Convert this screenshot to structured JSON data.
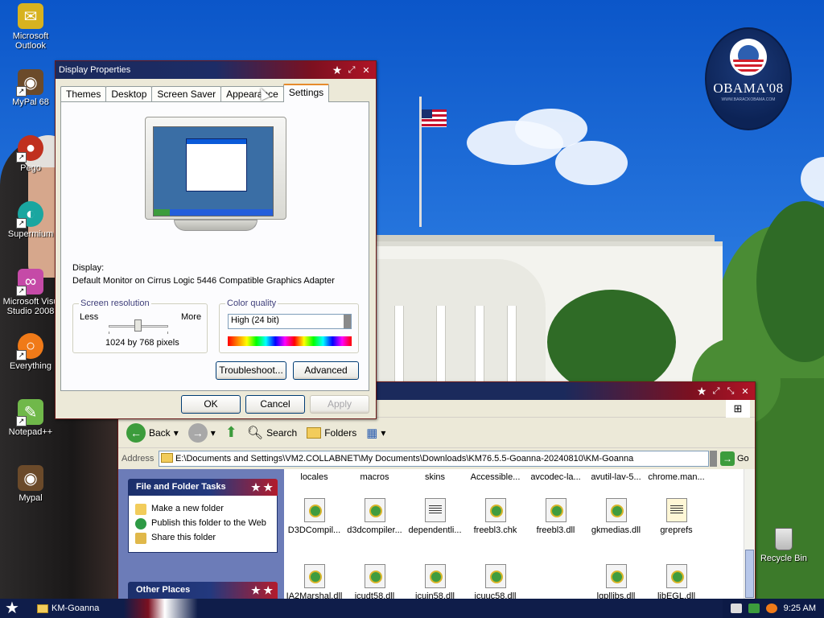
{
  "desktop": {
    "icons": [
      {
        "label": "Microsoft\nOutlook",
        "icon": "outlook-icon",
        "color": "#d7b21f"
      },
      {
        "label": "MyPal 68",
        "icon": "mypal-raccoon-icon",
        "color": "#6b4a2a"
      },
      {
        "label": "Pego",
        "icon": "pego-icon",
        "color": "#c0301e"
      },
      {
        "label": "Supermium",
        "icon": "supermium-icon",
        "color": "#1aa6a0"
      },
      {
        "label": "Microsoft Visu\nStudio 2008",
        "icon": "visual-studio-icon",
        "color": "#c54aa7"
      },
      {
        "label": "Everything",
        "icon": "everything-icon",
        "color": "#f07a18"
      },
      {
        "label": "Notepad++",
        "icon": "notepadpp-icon",
        "color": "#70b84a"
      },
      {
        "label": "Mypal",
        "icon": "mypal-raccoon-icon",
        "color": "#6b4a2a"
      }
    ],
    "recycle_bin": "Recycle Bin",
    "badge": {
      "brand": "OBAMA'08",
      "sub": "WWW.BARACKOBAMA.COM"
    }
  },
  "display_properties": {
    "title": "Display Properties",
    "tabs": [
      "Themes",
      "Desktop",
      "Screen Saver",
      "Appearance",
      "Settings"
    ],
    "active_tab": "Settings",
    "display_label": "Display:",
    "display_value": "Default Monitor on Cirrus Logic 5446 Compatible Graphics Adapter",
    "resolution": {
      "title": "Screen resolution",
      "less": "Less",
      "more": "More",
      "value": "1024 by 768 pixels"
    },
    "color_quality": {
      "title": "Color quality",
      "selected": "High (24 bit)"
    },
    "buttons": {
      "troubleshoot": "Troubleshoot...",
      "advanced": "Advanced",
      "ok": "OK",
      "cancel": "Cancel",
      "apply": "Apply"
    }
  },
  "explorer": {
    "toolbar": {
      "back": "Back",
      "search": "Search",
      "folders": "Folders"
    },
    "address_label": "Address",
    "address": "E:\\Documents and Settings\\VM2.COLLABNET\\My Documents\\Downloads\\KM76.5.5-Goanna-20240810\\KM-Goanna",
    "go": "Go",
    "task_panes": [
      {
        "title": "File and Folder Tasks",
        "items": [
          "Make a new folder",
          "Publish this folder to the Web",
          "Share this folder"
        ]
      },
      {
        "title": "Other Places",
        "items": []
      }
    ],
    "folders_row": [
      "locales",
      "macros",
      "skins",
      "Accessible...",
      "avcodec-la...",
      "avutil-lav-5...",
      "chrome.man..."
    ],
    "files_row1": [
      {
        "name": "D3DCompil...",
        "type": "dll"
      },
      {
        "name": "d3dcompiler...",
        "type": "dll"
      },
      {
        "name": "dependentli...",
        "type": "doc"
      },
      {
        "name": "freebl3.chk",
        "type": "dll"
      },
      {
        "name": "freebl3.dll",
        "type": "dll"
      },
      {
        "name": "gkmedias.dll",
        "type": "dll"
      },
      {
        "name": "greprefs",
        "type": "script"
      }
    ],
    "files_row2": [
      {
        "name": "IA2Marshal.dll",
        "type": "dll"
      },
      {
        "name": "icudt58.dll",
        "type": "dll"
      },
      {
        "name": "icuin58.dll",
        "type": "dll"
      },
      {
        "name": "icuuc58.dll",
        "type": "dll"
      },
      {
        "name": "",
        "type": "none"
      },
      {
        "name": "lgpllibs.dll",
        "type": "dll"
      },
      {
        "name": "libEGL.dll",
        "type": "dll"
      }
    ]
  },
  "taskbar": {
    "task": "KM-Goanna",
    "time": "9:25 AM"
  }
}
